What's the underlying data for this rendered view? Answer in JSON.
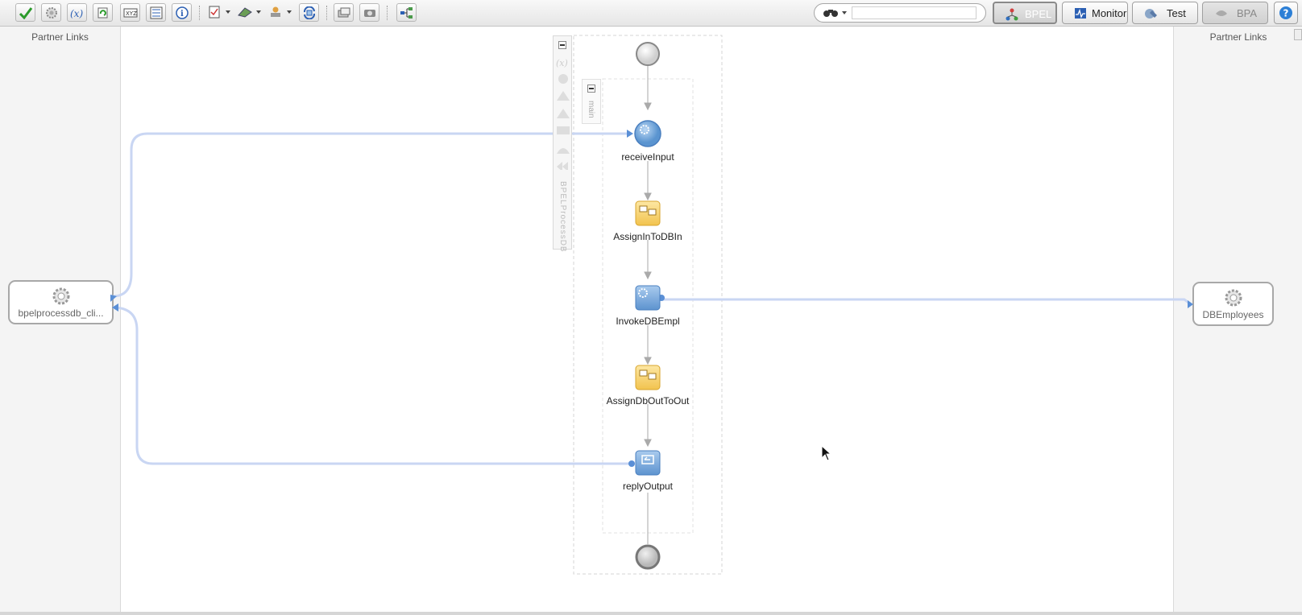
{
  "toolbar": {
    "buttons": [
      "validate-check-icon",
      "gear-settings-icon",
      "variables-icon",
      "refresh-icon",
      "xyz-expression-icon",
      "schema-table-icon",
      "info-icon",
      "checklist-icon",
      "deploy-icon",
      "stamp-icon",
      "sync-icon",
      "layers-icon",
      "camera-icon",
      "tree-diagram-icon"
    ],
    "search_placeholder": "",
    "modes": {
      "bpel": "BPEL",
      "monitor": "Monitor",
      "test": "Test",
      "bpa": "BPA"
    },
    "help_icon": "help-icon"
  },
  "partner_links": {
    "left_title": "Partner Links",
    "right_title": "Partner Links",
    "left": {
      "label": "bpelprocessdb_cli..."
    },
    "right": {
      "label": "DBEmployees"
    }
  },
  "process": {
    "name": "BPELProcessDB",
    "sequence": "main",
    "activities": [
      {
        "id": "receive",
        "label": "receiveInput",
        "type": "receive"
      },
      {
        "id": "assign1",
        "label": "AssignInToDBIn",
        "type": "assign"
      },
      {
        "id": "invoke",
        "label": "InvokeDBEmpl",
        "type": "invoke"
      },
      {
        "id": "assign2",
        "label": "AssignDbOutToOut",
        "type": "assign"
      },
      {
        "id": "reply",
        "label": "replyOutput",
        "type": "reply"
      }
    ]
  },
  "colors": {
    "link": "#c9d6f3",
    "activity_blue": "#6fa6d8",
    "assign_yellow": "#f7d36b",
    "accent": "#2c7fd6"
  }
}
